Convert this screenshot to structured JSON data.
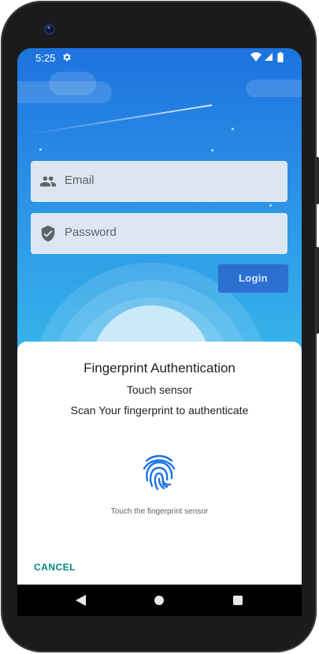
{
  "status_bar": {
    "time": "5:25",
    "icons": [
      "settings-icon",
      "wifi-icon",
      "signal-icon",
      "battery-icon"
    ]
  },
  "login_form": {
    "email_placeholder": "Email",
    "password_placeholder": "Password",
    "login_label": "Login",
    "email_icon": "people-icon",
    "password_icon": "shield-icon"
  },
  "fingerprint_dialog": {
    "title": "Fingerprint Authentication",
    "subtitle": "Touch sensor",
    "description": "Scan Your fingerprint to authenticate",
    "icon": "fingerprint-icon",
    "hint": "Touch the fingerprint sensor",
    "cancel_label": "CANCEL"
  },
  "nav_bar": {
    "buttons": [
      "back-icon",
      "home-icon",
      "recents-icon"
    ]
  },
  "colors": {
    "background_top": "#1e73de",
    "background_bottom": "#36c6e8",
    "accent_blue": "#2b6fd1",
    "fingerprint_blue": "#1a73e8",
    "cancel_teal": "#00897b"
  }
}
